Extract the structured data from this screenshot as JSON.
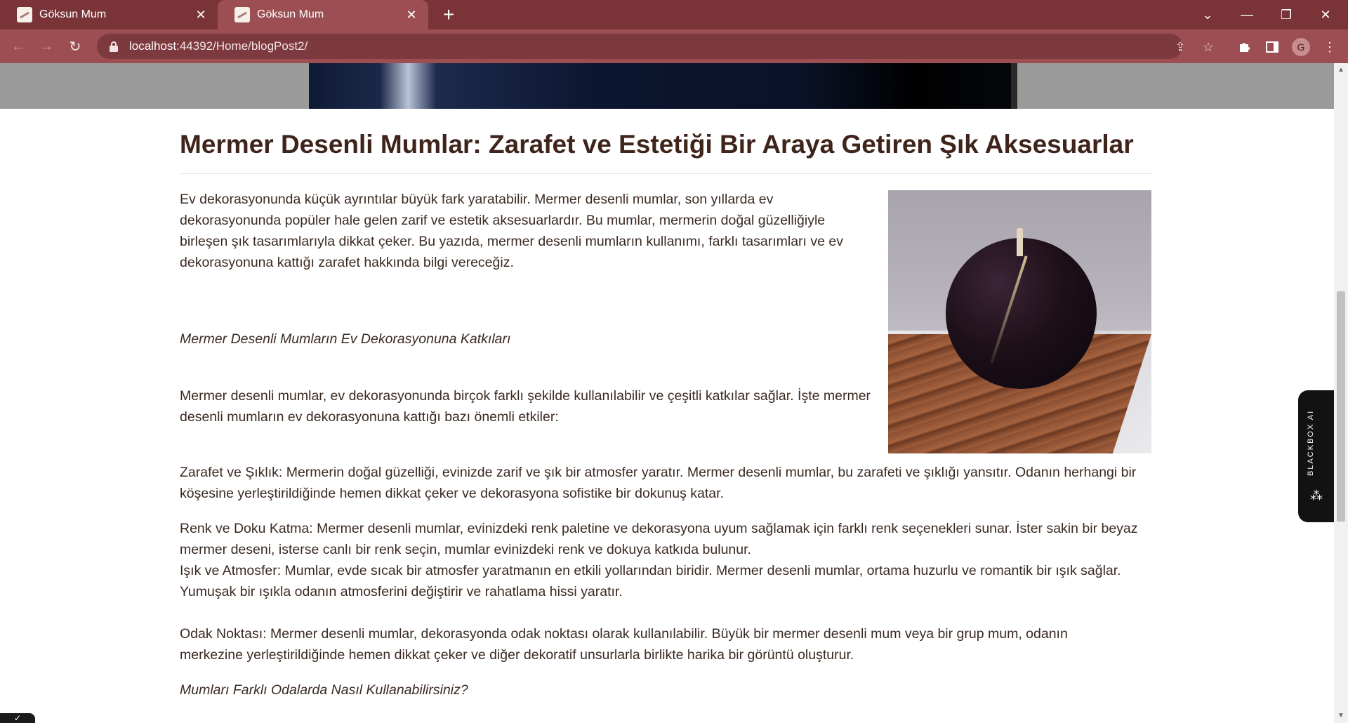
{
  "browser": {
    "tabs": [
      {
        "title": "Göksun Mum",
        "active": false
      },
      {
        "title": "Göksun Mum",
        "active": true
      }
    ],
    "url_host": "localhost",
    "url_rest": ":44392/Home/blogPost2/",
    "profile_initial": "G"
  },
  "article": {
    "title": "Mermer Desenli Mumlar: Zarafet ve Estetiği Bir Araya Getiren Şık Aksesuarlar",
    "intro_lines": [
      "Ev dekorasyonunda küçük ayrıntılar büyük fark yaratabilir. Mermer desenli mumlar, son yıllarda ev",
      "dekorasyonunda popüler hale gelen zarif ve estetik aksesuarlardır. Bu mumlar, mermerin doğal güzelliğiyle",
      "birleşen şık tasarımlarıyla dikkat çeker. Bu yazıda, mermer desenli mumların kullanımı, farklı tasarımları ve ev",
      "dekorasyonuna kattığı zarafet hakkında bilgi vereceğiz."
    ],
    "subheading1": "Mermer Desenli Mumların Ev Dekorasyonuna Katkıları",
    "para2_lines": [
      "Mermer desenli mumlar, ev dekorasyonunda birçok farklı şekilde kullanılabilir ve çeşitli katkılar sağlar. İşte mermer",
      "desenli mumların ev dekorasyonuna kattığı bazı önemli etkiler:"
    ],
    "para3_lines": [
      "Zarafet ve Şıklık: Mermerin doğal güzelliği, evinizde zarif ve şık bir atmosfer yaratır. Mermer desenli mumlar, bu zarafeti ve şıklığı yansıtır. Odanın herhangi bir",
      "köşesine yerleştirildiğinde hemen dikkat çeker ve dekorasyona sofistike bir dokunuş katar."
    ],
    "para4_lines": [
      "Renk ve Doku Katma: Mermer desenli mumlar, evinizdeki renk paletine ve dekorasyona uyum sağlamak için farklı renk seçenekleri sunar. İster sakin bir beyaz",
      "mermer deseni, isterse canlı bir renk seçin, mumlar evinizdeki renk ve dokuya katkıda bulunur.",
      "Işık ve Atmosfer: Mumlar, evde sıcak bir atmosfer yaratmanın en etkili yollarından biridir. Mermer desenli mumlar, ortama huzurlu ve romantik bir ışık sağlar.",
      "Yumuşak bir ışıkla odanın atmosferini değiştirir ve rahatlama hissi yaratır."
    ],
    "para5_lines": [
      "Odak Noktası: Mermer desenli mumlar, dekorasyonda odak noktası olarak kullanılabilir. Büyük bir mermer desenli mum veya bir grup mum, odanın",
      "merkezine yerleştirildiğinde hemen dikkat çeker ve diğer dekoratif unsurlarla birlikte harika bir görüntü oluşturur."
    ],
    "subheading2": "Mumları Farklı Odalarda Nasıl Kullanabilirsiniz?"
  },
  "widget": {
    "label": "BLACKBOX AI"
  },
  "icons": {
    "back": "arrow-left-icon",
    "forward": "arrow-right-icon",
    "reload": "reload-icon",
    "lock": "lock-icon",
    "share": "share-icon",
    "star": "star-icon",
    "extensions": "puzzle-icon",
    "sidepanel": "side-panel-icon",
    "menu": "kebab-menu-icon"
  }
}
